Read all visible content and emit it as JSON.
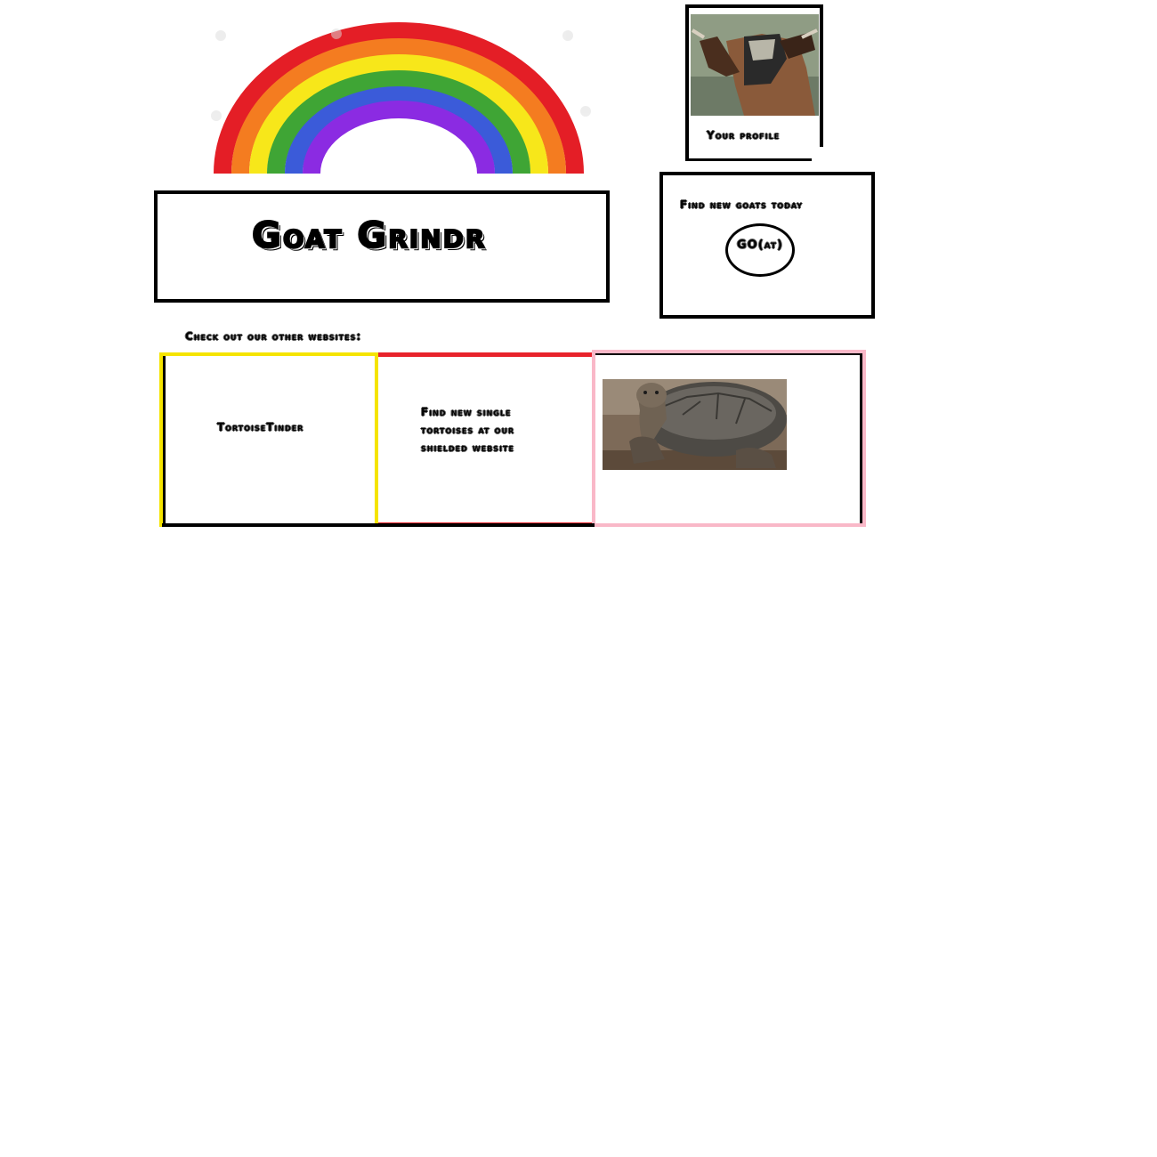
{
  "app": {
    "title": "Goat Grindr"
  },
  "profile": {
    "label": "Your profile",
    "photo": "goat-photo"
  },
  "find": {
    "text": "Find new goats today",
    "button_label": "GO(at)"
  },
  "other_sites": {
    "heading": "Check out our other websites:",
    "site_name": "TortoiseTinder",
    "description": "Find new single tortoises at our shielded website",
    "photo": "tortoise-photo"
  },
  "colors": {
    "tile_yellow": "#f5e400",
    "tile_red": "#e8232b",
    "tile_pink": "#f9b8c8",
    "rainbow": [
      "#e41e26",
      "#f47c20",
      "#f7e71a",
      "#3fa535",
      "#3b5bd9",
      "#8b2be2"
    ]
  },
  "decorations": {
    "header_image": "rainbow"
  }
}
